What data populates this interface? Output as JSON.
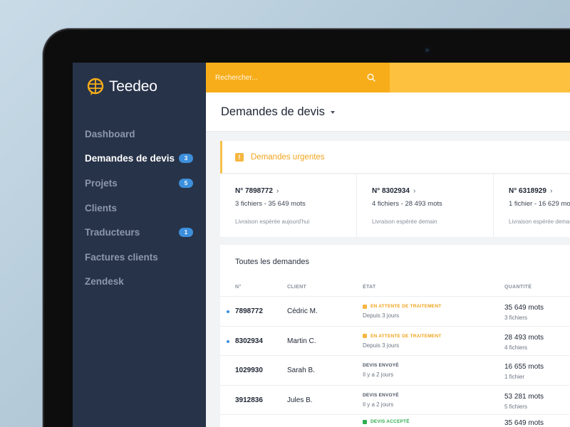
{
  "app": {
    "logo_text": "Teedeo"
  },
  "sidebar": {
    "items": [
      {
        "label": "Dashboard",
        "badge": ""
      },
      {
        "label": "Demandes de devis",
        "badge": "3"
      },
      {
        "label": "Projets",
        "badge": "5"
      },
      {
        "label": "Clients",
        "badge": ""
      },
      {
        "label": "Traducteurs",
        "badge": "1"
      },
      {
        "label": "Factures clients",
        "badge": ""
      },
      {
        "label": "Zendesk",
        "badge": ""
      }
    ]
  },
  "search": {
    "placeholder": "Rechercher..."
  },
  "header": {
    "title": "Demandes de devis"
  },
  "urgent": {
    "title": "Demandes urgentes",
    "cards": [
      {
        "number": "N° 7898772",
        "files": "3 fichiers - 35 649 mots",
        "delivery": "Livraison espérée aujourd'hui"
      },
      {
        "number": "N° 8302934",
        "files": "4 fichiers - 28 493 mots",
        "delivery": "Livraison espérée demain"
      },
      {
        "number": "N° 6318929",
        "files": "1 fichier - 16 629 mots",
        "delivery": "Livraison espérée demain"
      }
    ]
  },
  "table": {
    "title": "Toutes les demandes",
    "headers": {
      "number": "N°",
      "client": "CLIENT",
      "status": "ÉTAT",
      "quantity": "QUANTITÉ"
    },
    "rows": [
      {
        "number": "7898772",
        "client": "Cédric M.",
        "status": "EN ATTENTE DE TRAITEMENT",
        "status_sub": "Depuis 3 jours",
        "qty": "35 649 mots",
        "qty_sub": "3 fichiers"
      },
      {
        "number": "8302934",
        "client": "Martin C.",
        "status": "EN ATTENTE DE TRAITEMENT",
        "status_sub": "Depuis 3 jours",
        "qty": "28 493 mots",
        "qty_sub": "4 fichiers"
      },
      {
        "number": "1029930",
        "client": "Sarah B.",
        "status": "DEVIS ENVOYÉ",
        "status_sub": "Il y a 2 jours",
        "qty": "16 655 mots",
        "qty_sub": "1 fichier"
      },
      {
        "number": "3912836",
        "client": "Jules B.",
        "status": "DEVIS ENVOYÉ",
        "status_sub": "Il y a 2 jours",
        "qty": "53 281 mots",
        "qty_sub": "5 fichiers"
      },
      {
        "number": "",
        "client": "",
        "status": "DEVIS ACCEPTÉ",
        "status_sub": "",
        "qty": "35 649 mots",
        "qty_sub": ""
      }
    ]
  },
  "colors": {
    "sidebar": "#273349",
    "search": "#f7ad1a",
    "topbar": "#fec13f",
    "badge": "#3d8fdb",
    "status_pending": "#f0a41d",
    "status_sent": "#4a5262",
    "status_accepted": "#2fae4f"
  }
}
